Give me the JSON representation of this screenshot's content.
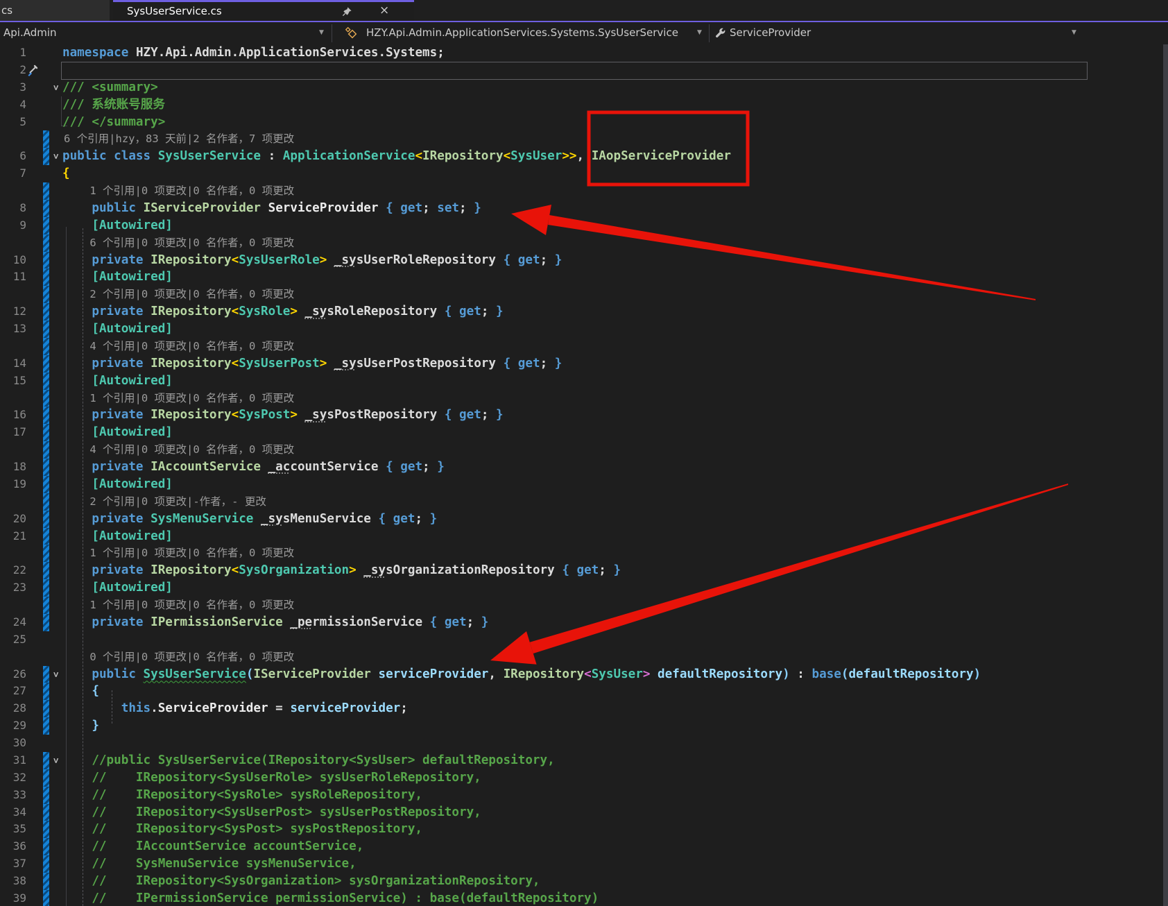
{
  "tabs": {
    "inactive_label": "cs",
    "active_label": "SysUserService.cs",
    "close_glyph": "×"
  },
  "breadcrumb": {
    "project": "Api.Admin",
    "type_path": "HZY.Api.Admin.ApplicationServices.Systems.SysUserService",
    "member": "ServiceProvider",
    "dropdown_glyph": "▼"
  },
  "colors": {
    "accent_purple": "#6e5fe0",
    "annotation_red": "#e81309",
    "editor_bg": "#1e1e1e",
    "change_bar_blue": "#1583d8"
  },
  "annotations": {
    "box_target_text": "IAopServiceProvider",
    "arrow_1_target": "public IServiceProvider ServiceProvider { get; set; }",
    "arrow_2_target": "SysUserService(IServiceProvider serviceProvider"
  },
  "editor": {
    "rows": [
      {
        "t": "code",
        "n": "1",
        "segs": [
          [
            "k",
            "namespace "
          ],
          [
            "d",
            "HZY.Api.Admin.ApplicationServices.Systems;"
          ]
        ]
      },
      {
        "t": "code",
        "n": "2",
        "cursor": true,
        "screw": true,
        "segs": []
      },
      {
        "t": "code",
        "n": "3",
        "chev": true,
        "segs": [
          [
            "c",
            "/// <summary>"
          ]
        ]
      },
      {
        "t": "code",
        "n": "4",
        "segs": [
          [
            "c",
            "/// 系统账号服务"
          ]
        ]
      },
      {
        "t": "code",
        "n": "5",
        "segs": [
          [
            "c",
            "/// </summary>"
          ]
        ]
      },
      {
        "t": "lens",
        "bar": true,
        "text": "6 个引用|hzy，83 天前|2 名作者，7 项更改"
      },
      {
        "t": "code",
        "n": "6",
        "bar": true,
        "chev": true,
        "segs": [
          [
            "k",
            "public class "
          ],
          [
            "t",
            "SysUserService"
          ],
          [
            "d",
            " : "
          ],
          [
            "t",
            "ApplicationService"
          ],
          [
            "g",
            "<"
          ],
          [
            "i",
            "IRepository"
          ],
          [
            "g",
            "<"
          ],
          [
            "t",
            "SysUser"
          ],
          [
            "g",
            ">>"
          ],
          [
            "d",
            ", "
          ],
          [
            "i",
            "IAopServiceProvider"
          ]
        ]
      },
      {
        "t": "code",
        "n": "7",
        "segs": [
          [
            "g",
            "{"
          ]
        ]
      },
      {
        "t": "lens",
        "bar": true,
        "text": "    1 个引用|0 项更改|0 名作者，0 项更改"
      },
      {
        "t": "code",
        "n": "8",
        "bar": true,
        "segs": [
          [
            "k",
            "    public "
          ],
          [
            "i",
            "IServiceProvider"
          ],
          [
            "d",
            " "
          ],
          [
            "w",
            "ServiceProvider"
          ],
          [
            "d",
            " "
          ],
          [
            "bb",
            "{ "
          ],
          [
            "k",
            "get"
          ],
          [
            "d",
            "; "
          ],
          [
            "k",
            "set"
          ],
          [
            "d",
            "; "
          ],
          [
            "bb",
            "}"
          ]
        ]
      },
      {
        "t": "code",
        "n": "9",
        "bar": true,
        "segs": [
          [
            "t",
            "    [Autowired]"
          ]
        ]
      },
      {
        "t": "lens",
        "bar": true,
        "text": "    6 个引用|0 项更改|0 名作者，0 项更改"
      },
      {
        "t": "code",
        "n": "10",
        "bar": true,
        "segs": [
          [
            "k",
            "    private "
          ],
          [
            "i",
            "IRepository"
          ],
          [
            "g",
            "<"
          ],
          [
            "t",
            "SysUserRole"
          ],
          [
            "g",
            "> "
          ],
          [
            "fd",
            "_sy"
          ],
          [
            "d",
            "sUserRoleRepository "
          ],
          [
            "bb",
            "{ "
          ],
          [
            "k",
            "get"
          ],
          [
            "d",
            "; "
          ],
          [
            "bb",
            "}"
          ]
        ]
      },
      {
        "t": "code",
        "n": "11",
        "bar": true,
        "segs": [
          [
            "t",
            "    [Autowired]"
          ]
        ]
      },
      {
        "t": "lens",
        "bar": true,
        "text": "    2 个引用|0 项更改|0 名作者，0 项更改"
      },
      {
        "t": "code",
        "n": "12",
        "bar": true,
        "segs": [
          [
            "k",
            "    private "
          ],
          [
            "i",
            "IRepository"
          ],
          [
            "g",
            "<"
          ],
          [
            "t",
            "SysRole"
          ],
          [
            "g",
            "> "
          ],
          [
            "fd",
            "_sy"
          ],
          [
            "d",
            "sRoleRepository "
          ],
          [
            "bb",
            "{ "
          ],
          [
            "k",
            "get"
          ],
          [
            "d",
            "; "
          ],
          [
            "bb",
            "}"
          ]
        ]
      },
      {
        "t": "code",
        "n": "13",
        "bar": true,
        "segs": [
          [
            "t",
            "    [Autowired]"
          ]
        ]
      },
      {
        "t": "lens",
        "bar": true,
        "text": "    4 个引用|0 项更改|0 名作者，0 项更改"
      },
      {
        "t": "code",
        "n": "14",
        "bar": true,
        "segs": [
          [
            "k",
            "    private "
          ],
          [
            "i",
            "IRepository"
          ],
          [
            "g",
            "<"
          ],
          [
            "t",
            "SysUserPost"
          ],
          [
            "g",
            "> "
          ],
          [
            "fd",
            "_sy"
          ],
          [
            "d",
            "sUserPostRepository "
          ],
          [
            "bb",
            "{ "
          ],
          [
            "k",
            "get"
          ],
          [
            "d",
            "; "
          ],
          [
            "bb",
            "}"
          ]
        ]
      },
      {
        "t": "code",
        "n": "15",
        "bar": true,
        "segs": [
          [
            "t",
            "    [Autowired]"
          ]
        ]
      },
      {
        "t": "lens",
        "bar": true,
        "text": "    1 个引用|0 项更改|0 名作者，0 项更改"
      },
      {
        "t": "code",
        "n": "16",
        "bar": true,
        "segs": [
          [
            "k",
            "    private "
          ],
          [
            "i",
            "IRepository"
          ],
          [
            "g",
            "<"
          ],
          [
            "t",
            "SysPost"
          ],
          [
            "g",
            "> "
          ],
          [
            "fd",
            "_sy"
          ],
          [
            "d",
            "sPostRepository "
          ],
          [
            "bb",
            "{ "
          ],
          [
            "k",
            "get"
          ],
          [
            "d",
            "; "
          ],
          [
            "bb",
            "}"
          ]
        ]
      },
      {
        "t": "code",
        "n": "17",
        "bar": true,
        "segs": [
          [
            "t",
            "    [Autowired]"
          ]
        ]
      },
      {
        "t": "lens",
        "bar": true,
        "text": "    4 个引用|0 项更改|0 名作者，0 项更改"
      },
      {
        "t": "code",
        "n": "18",
        "bar": true,
        "segs": [
          [
            "k",
            "    private "
          ],
          [
            "i",
            "IAccountService"
          ],
          [
            "d",
            " "
          ],
          [
            "fd",
            "_ac"
          ],
          [
            "d",
            "countService "
          ],
          [
            "bb",
            "{ "
          ],
          [
            "k",
            "get"
          ],
          [
            "d",
            "; "
          ],
          [
            "bb",
            "}"
          ]
        ]
      },
      {
        "t": "code",
        "n": "19",
        "bar": true,
        "segs": [
          [
            "t",
            "    [Autowired]"
          ]
        ]
      },
      {
        "t": "lens",
        "bar": true,
        "text": "    2 个引用|0 项更改|-作者，- 更改"
      },
      {
        "t": "code",
        "n": "20",
        "bar": true,
        "segs": [
          [
            "k",
            "    private "
          ],
          [
            "t",
            "SysMenuService"
          ],
          [
            "d",
            " "
          ],
          [
            "fd",
            "_sy"
          ],
          [
            "d",
            "sMenuService "
          ],
          [
            "bb",
            "{ "
          ],
          [
            "k",
            "get"
          ],
          [
            "d",
            "; "
          ],
          [
            "bb",
            "}"
          ]
        ]
      },
      {
        "t": "code",
        "n": "21",
        "bar": true,
        "segs": [
          [
            "t",
            "    [Autowired]"
          ]
        ]
      },
      {
        "t": "lens",
        "bar": true,
        "text": "    1 个引用|0 项更改|0 名作者，0 项更改"
      },
      {
        "t": "code",
        "n": "22",
        "bar": true,
        "segs": [
          [
            "k",
            "    private "
          ],
          [
            "i",
            "IRepository"
          ],
          [
            "g",
            "<"
          ],
          [
            "t",
            "SysOrganization"
          ],
          [
            "g",
            "> "
          ],
          [
            "fd",
            "_sy"
          ],
          [
            "d",
            "sOrganizationRepository "
          ],
          [
            "bb",
            "{ "
          ],
          [
            "k",
            "get"
          ],
          [
            "d",
            "; "
          ],
          [
            "bb",
            "}"
          ]
        ]
      },
      {
        "t": "code",
        "n": "23",
        "bar": true,
        "segs": [
          [
            "t",
            "    [Autowired]"
          ]
        ]
      },
      {
        "t": "lens",
        "bar": true,
        "text": "    1 个引用|0 项更改|0 名作者，0 项更改"
      },
      {
        "t": "code",
        "n": "24",
        "bar": true,
        "segs": [
          [
            "k",
            "    private "
          ],
          [
            "i",
            "IPermissionService"
          ],
          [
            "d",
            " "
          ],
          [
            "fd",
            "_pe"
          ],
          [
            "d",
            "rmissionService "
          ],
          [
            "bb",
            "{ "
          ],
          [
            "k",
            "get"
          ],
          [
            "d",
            "; "
          ],
          [
            "bb",
            "}"
          ]
        ]
      },
      {
        "t": "code",
        "n": "25",
        "segs": []
      },
      {
        "t": "lens",
        "text": "    0 个引用|0 项更改|0 名作者，0 项更改"
      },
      {
        "t": "code",
        "n": "26",
        "bar": true,
        "chev": true,
        "segs": [
          [
            "k",
            "    public "
          ],
          [
            "sq",
            "SysUserService"
          ],
          [
            "lb",
            "("
          ],
          [
            "i",
            "IServiceProvider"
          ],
          [
            "d",
            " "
          ],
          [
            "p",
            "serviceProvider"
          ],
          [
            "d",
            ", "
          ],
          [
            "i",
            "IRepository"
          ],
          [
            "pk",
            "<"
          ],
          [
            "t",
            "SysUser"
          ],
          [
            "pk",
            ">"
          ],
          [
            "d",
            " "
          ],
          [
            "p",
            "defaultRepository"
          ],
          [
            "lb",
            ")"
          ],
          [
            "d",
            " : "
          ],
          [
            "k",
            "base"
          ],
          [
            "lb",
            "("
          ],
          [
            "p",
            "defaultRepository"
          ],
          [
            "lb",
            ")"
          ]
        ]
      },
      {
        "t": "code",
        "n": "27",
        "bar": true,
        "segs": [
          [
            "lb",
            "    {"
          ]
        ]
      },
      {
        "t": "code",
        "n": "28",
        "bar": true,
        "segs": [
          [
            "k",
            "        this"
          ],
          [
            "d",
            "."
          ],
          [
            "w",
            "ServiceProvider"
          ],
          [
            "d",
            " = "
          ],
          [
            "p",
            "serviceProvider"
          ],
          [
            "d",
            ";"
          ]
        ]
      },
      {
        "t": "code",
        "n": "29",
        "bar": true,
        "segs": [
          [
            "lb",
            "    }"
          ]
        ]
      },
      {
        "t": "code",
        "n": "30",
        "segs": []
      },
      {
        "t": "code",
        "n": "31",
        "bar": true,
        "chev": true,
        "segs": [
          [
            "c",
            "    //public SysUserService(IRepository<SysUser> defaultRepository,"
          ]
        ]
      },
      {
        "t": "code",
        "n": "32",
        "bar": true,
        "segs": [
          [
            "c",
            "    //    IRepository<SysUserRole> sysUserRoleRepository,"
          ]
        ]
      },
      {
        "t": "code",
        "n": "33",
        "bar": true,
        "segs": [
          [
            "c",
            "    //    IRepository<SysRole> sysRoleRepository,"
          ]
        ]
      },
      {
        "t": "code",
        "n": "34",
        "bar": true,
        "segs": [
          [
            "c",
            "    //    IRepository<SysUserPost> sysUserPostRepository,"
          ]
        ]
      },
      {
        "t": "code",
        "n": "35",
        "bar": true,
        "segs": [
          [
            "c",
            "    //    IRepository<SysPost> sysPostRepository,"
          ]
        ]
      },
      {
        "t": "code",
        "n": "36",
        "bar": true,
        "segs": [
          [
            "c",
            "    //    IAccountService accountService,"
          ]
        ]
      },
      {
        "t": "code",
        "n": "37",
        "bar": true,
        "segs": [
          [
            "c",
            "    //    SysMenuService sysMenuService,"
          ]
        ]
      },
      {
        "t": "code",
        "n": "38",
        "bar": true,
        "segs": [
          [
            "c",
            "    //    IRepository<SysOrganization> sysOrganizationRepository,"
          ]
        ]
      },
      {
        "t": "code",
        "n": "39",
        "bar": true,
        "segs": [
          [
            "c",
            "    //    IPermissionService permissionService) : base(defaultRepository)"
          ]
        ]
      }
    ]
  }
}
